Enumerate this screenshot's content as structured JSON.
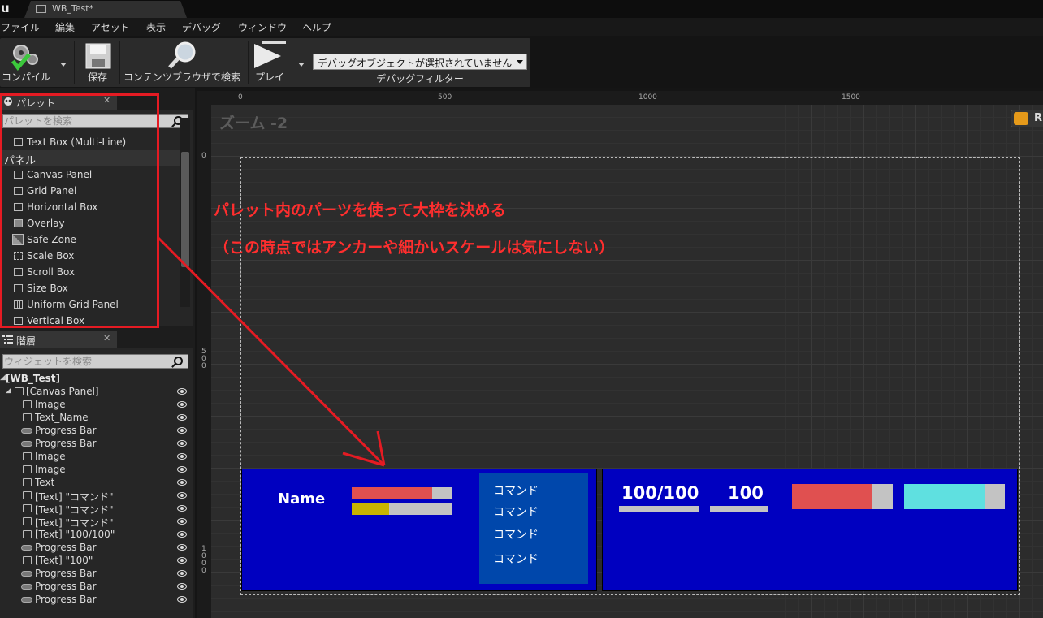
{
  "titlebar": {
    "tab_title": "WB_Test*"
  },
  "menu": [
    "ファイル",
    "編集",
    "アセット",
    "表示",
    "デバッグ",
    "ウィンドウ",
    "ヘルプ"
  ],
  "toolbar": {
    "compile_label": "コンパイル",
    "save_label": "保存",
    "browse_label": "コンテンツブラウザで検索",
    "play_label": "プレイ",
    "debug_select_value": "デバッグオブジェクトが選択されていません",
    "debug_filter_label": "デバッグフィルター"
  },
  "palette": {
    "title": "パレット",
    "search_placeholder": "パレットを検索",
    "top_item": "Text Box (Multi-Line)",
    "category": "パネル",
    "items": [
      "Canvas Panel",
      "Grid Panel",
      "Horizontal Box",
      "Overlay",
      "Safe Zone",
      "Scale Box",
      "Scroll Box",
      "Size Box",
      "Uniform Grid Panel",
      "Vertical Box"
    ]
  },
  "hierarchy": {
    "title": "階層",
    "search_placeholder": "ウィジェットを検索",
    "root": "[WB_Test]",
    "canvas": "[Canvas Panel]",
    "rows": [
      {
        "type": "img",
        "label": "Image"
      },
      {
        "type": "txt",
        "label": "Text_Name"
      },
      {
        "type": "pb",
        "label": "Progress Bar"
      },
      {
        "type": "pb",
        "label": "Progress Bar"
      },
      {
        "type": "img",
        "label": "Image"
      },
      {
        "type": "img",
        "label": "Image"
      },
      {
        "type": "txt",
        "label": "Text"
      },
      {
        "type": "txt",
        "label": "[Text] \"コマンド\""
      },
      {
        "type": "txt",
        "label": "[Text] \"コマンド\""
      },
      {
        "type": "txt",
        "label": "[Text] \"コマンド\""
      },
      {
        "type": "txt",
        "label": "[Text] \"100/100\""
      },
      {
        "type": "pb",
        "label": "Progress Bar"
      },
      {
        "type": "txt",
        "label": "[Text] \"100\""
      },
      {
        "type": "pb",
        "label": "Progress Bar"
      },
      {
        "type": "pb",
        "label": "Progress Bar"
      },
      {
        "type": "pb",
        "label": "Progress Bar"
      }
    ]
  },
  "designer": {
    "zoom_label": "ズーム -2",
    "ruler_top": [
      "0",
      "500",
      "1000",
      "1500"
    ],
    "ruler_left": [
      "0",
      "500",
      "1000"
    ],
    "r_button": "R"
  },
  "widget": {
    "name_label": "Name",
    "name_bar1_percent": 80,
    "name_bar2_percent": 37,
    "commands": [
      "コマンド",
      "コマンド",
      "コマンド",
      "コマンド"
    ],
    "hp_text": "100/100",
    "mp_text": "100",
    "bar_red_percent": 80,
    "bar_cyan_percent": 80,
    "colors": {
      "panel_blue": "#0000c0",
      "command_blue": "#0047ab",
      "bar_red": "#e05050",
      "bar_yellow": "#c8b400",
      "bar_cyan": "#5fe0e0"
    }
  },
  "annotations": {
    "line1": "パレット内のパーツを使って大枠を決める",
    "line2": "（この時点ではアンカーや細かいスケールは気にしない）",
    "color": "#ff2e2e"
  }
}
